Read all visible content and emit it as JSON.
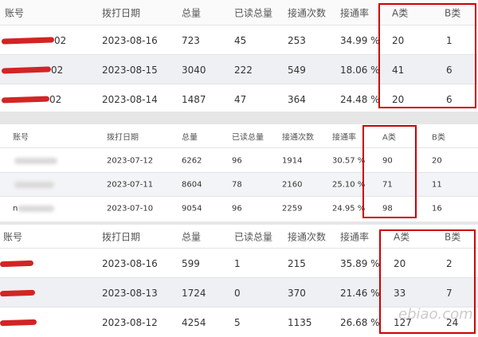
{
  "colors": {
    "highlight_box": "#cc0000",
    "redaction": "#d32424"
  },
  "panel1": {
    "headers": [
      "账号",
      "拨打日期",
      "总量",
      "已读总量",
      "接通次数",
      "接通率",
      "A类",
      "B类"
    ],
    "rows": [
      {
        "account": "02",
        "date": "2023-08-16",
        "total": "723",
        "read": "45",
        "connected": "253",
        "rate": "34.99 %",
        "a": "20",
        "b": "1"
      },
      {
        "account": "02",
        "date": "2023-08-15",
        "total": "3040",
        "read": "222",
        "connected": "549",
        "rate": "18.06 %",
        "a": "41",
        "b": "6"
      },
      {
        "account": "02",
        "date": "2023-08-14",
        "total": "1487",
        "read": "47",
        "connected": "364",
        "rate": "24.48 %",
        "a": "20",
        "b": "6"
      }
    ]
  },
  "panel2": {
    "headers": [
      "账号",
      "拨打日期",
      "总量",
      "已读总量",
      "接通次数",
      "接通率",
      "A类",
      "B类"
    ],
    "rows": [
      {
        "account": "",
        "date": "2023-07-12",
        "total": "6262",
        "read": "96",
        "connected": "1914",
        "rate": "30.57 %",
        "a": "90",
        "b": "20"
      },
      {
        "account": "",
        "date": "2023-07-11",
        "total": "8604",
        "read": "78",
        "connected": "2160",
        "rate": "25.10 %",
        "a": "71",
        "b": "11"
      },
      {
        "account": "n",
        "date": "2023-07-10",
        "total": "9054",
        "read": "96",
        "connected": "2259",
        "rate": "24.95 %",
        "a": "98",
        "b": "16"
      }
    ]
  },
  "panel3": {
    "headers": [
      "账号",
      "拨打日期",
      "总量",
      "已读总量",
      "接通次数",
      "接通率",
      "A类",
      "B类"
    ],
    "rows": [
      {
        "account": "",
        "date": "2023-08-16",
        "total": "599",
        "read": "1",
        "connected": "215",
        "rate": "35.89 %",
        "a": "20",
        "b": "2"
      },
      {
        "account": "",
        "date": "2023-08-13",
        "total": "1724",
        "read": "0",
        "connected": "370",
        "rate": "21.46 %",
        "a": "33",
        "b": "7"
      },
      {
        "account": "",
        "date": "2023-08-12",
        "total": "4254",
        "read": "5",
        "connected": "1135",
        "rate": "26.68 %",
        "a": "127",
        "b": "24"
      }
    ]
  },
  "watermark": "ebiao.com"
}
